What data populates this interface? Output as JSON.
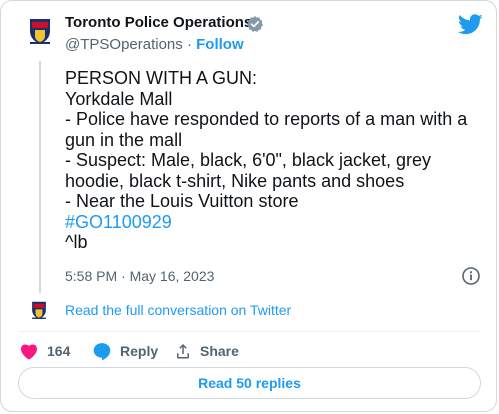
{
  "author": {
    "name": "Toronto Police Operations",
    "handle": "@TPSOperations",
    "separator": "·",
    "follow_label": "Follow"
  },
  "tweet": {
    "lines": [
      "PERSON WITH A GUN:",
      "Yorkdale Mall",
      "- Police have responded to reports of a man with a",
      "gun in the mall",
      "- Suspect: Male, black, 6'0\", black jacket, grey",
      "hoodie, black t-shirt, Nike pants and shoes",
      "- Near the Louis Vuitton store"
    ],
    "hashtag": "#GO1100929",
    "signature": "^lb"
  },
  "timestamp": "5:58 PM · May 16, 2023",
  "conversation_link": "Read the full conversation on Twitter",
  "actions": {
    "like_count": "164",
    "reply_label": "Reply",
    "share_label": "Share"
  },
  "read_replies_label": "Read 50 replies",
  "colors": {
    "link": "#1d9bf0",
    "like": "#f91880",
    "secondary_text": "#536471",
    "border": "#cfd9de"
  },
  "icons": [
    "police-logo-icon",
    "verified-badge-icon",
    "twitter-bird-icon",
    "info-icon",
    "heart-icon",
    "reply-bubble-icon",
    "share-icon"
  ]
}
